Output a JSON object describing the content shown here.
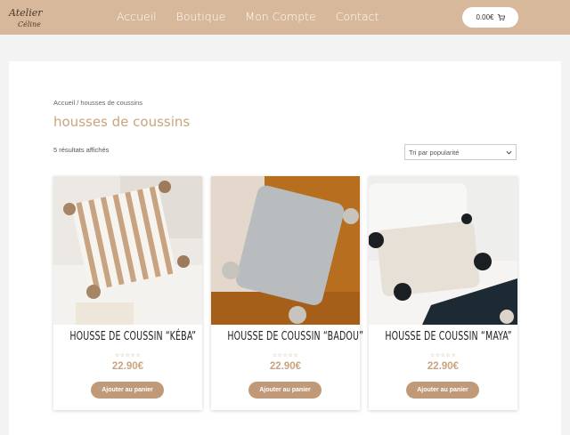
{
  "header": {
    "logo_text": "Atelier Céline",
    "nav": [
      "Accueil",
      "Boutique",
      "Mon Compte",
      "Contact"
    ],
    "cart_total": "0.00€"
  },
  "breadcrumb": "Accueil / housses de coussins",
  "page_title": "housses de coussins",
  "results_text": "5 résultats affichés",
  "sort": {
    "selected": "Tri par popularité"
  },
  "products": [
    {
      "title": "HOUSSE DE COUSSIN “KÉBA”",
      "price": "22.90€",
      "button": "Ajouter au panier",
      "stars": "☆☆☆☆☆"
    },
    {
      "title": "HOUSSE DE COUSSIN “BADOU”",
      "price": "22.90€",
      "button": "Ajouter au panier",
      "stars": "☆☆☆☆☆"
    },
    {
      "title": "HOUSSE DE COUSSIN “MAYA”",
      "price": "22.90€",
      "button": "Ajouter au panier",
      "stars": "☆☆☆☆☆"
    }
  ],
  "colors": {
    "header": "#d8b89a",
    "accent": "#c9a47f",
    "button": "#c09a78"
  }
}
